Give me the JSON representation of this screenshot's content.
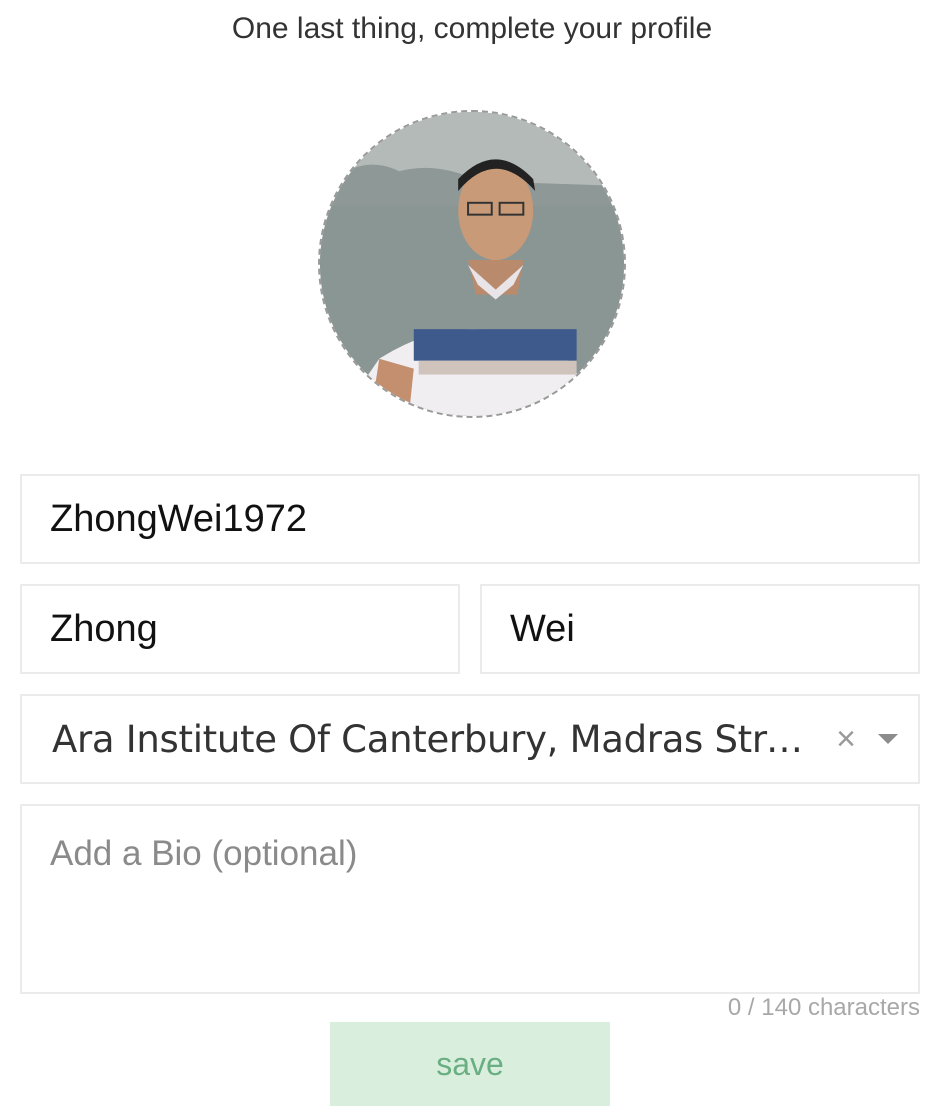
{
  "header": {
    "title": "One last thing, complete your profile"
  },
  "profile": {
    "username": "ZhongWei1972",
    "first_name": "Zhong",
    "last_name": "Wei",
    "institution": "Ara Institute Of Canterbury, Madras Street…",
    "bio_placeholder": "Add a Bio (optional)",
    "bio_counter": "0 / 140 characters"
  },
  "actions": {
    "save_label": "save"
  },
  "icons": {
    "clear": "close-icon",
    "dropdown": "caret-down-icon"
  },
  "colors": {
    "save_bg": "#d9eedd",
    "save_text": "#6aaf82",
    "border": "#ebebeb",
    "placeholder": "#8a8a8a"
  }
}
